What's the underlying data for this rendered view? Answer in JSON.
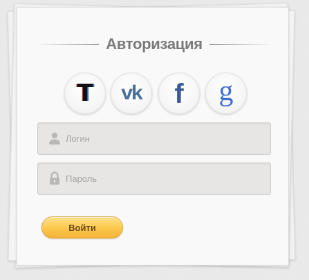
{
  "form": {
    "title": "Авторизация",
    "social": [
      {
        "icon": "tumblr-t-icon",
        "glyph": "T"
      },
      {
        "icon": "vk-icon",
        "glyph": "vk"
      },
      {
        "icon": "facebook-icon",
        "glyph": "f"
      },
      {
        "icon": "google-icon",
        "glyph": "g"
      }
    ],
    "login": {
      "placeholder": "Логин",
      "value": ""
    },
    "password": {
      "placeholder": "Пароль",
      "value": ""
    },
    "submit_label": "Войти"
  },
  "colors": {
    "title": "#7a7a7a",
    "field_bg": "#e7e6e4",
    "button_accent": "#fcc84c",
    "vk": "#4a6f97",
    "facebook": "#3b5a94",
    "google": "#3c6fcf"
  }
}
